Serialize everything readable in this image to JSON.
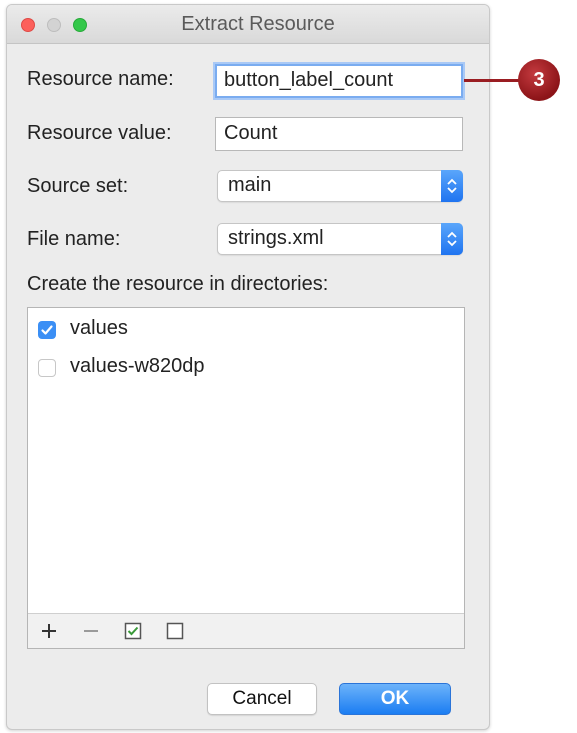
{
  "window": {
    "title": "Extract Resource"
  },
  "form": {
    "resource_name": {
      "label": "Resource name:",
      "value": "button_label_count"
    },
    "resource_value": {
      "label": "Resource value:",
      "value": "Count"
    },
    "source_set": {
      "label": "Source set:",
      "selected": "main"
    },
    "file_name": {
      "label": "File name:",
      "selected": "strings.xml"
    },
    "directories_label": "Create the resource in directories:"
  },
  "directories": [
    {
      "label": "values",
      "checked": true
    },
    {
      "label": "values-w820dp",
      "checked": false
    }
  ],
  "buttons": {
    "cancel": "Cancel",
    "ok": "OK"
  },
  "callout": {
    "number": "3",
    "color": "#9a1d22"
  },
  "icons": {
    "add": "plus-icon",
    "remove": "minus-icon",
    "select_all": "checked-box-icon",
    "select_none": "empty-box-icon"
  }
}
